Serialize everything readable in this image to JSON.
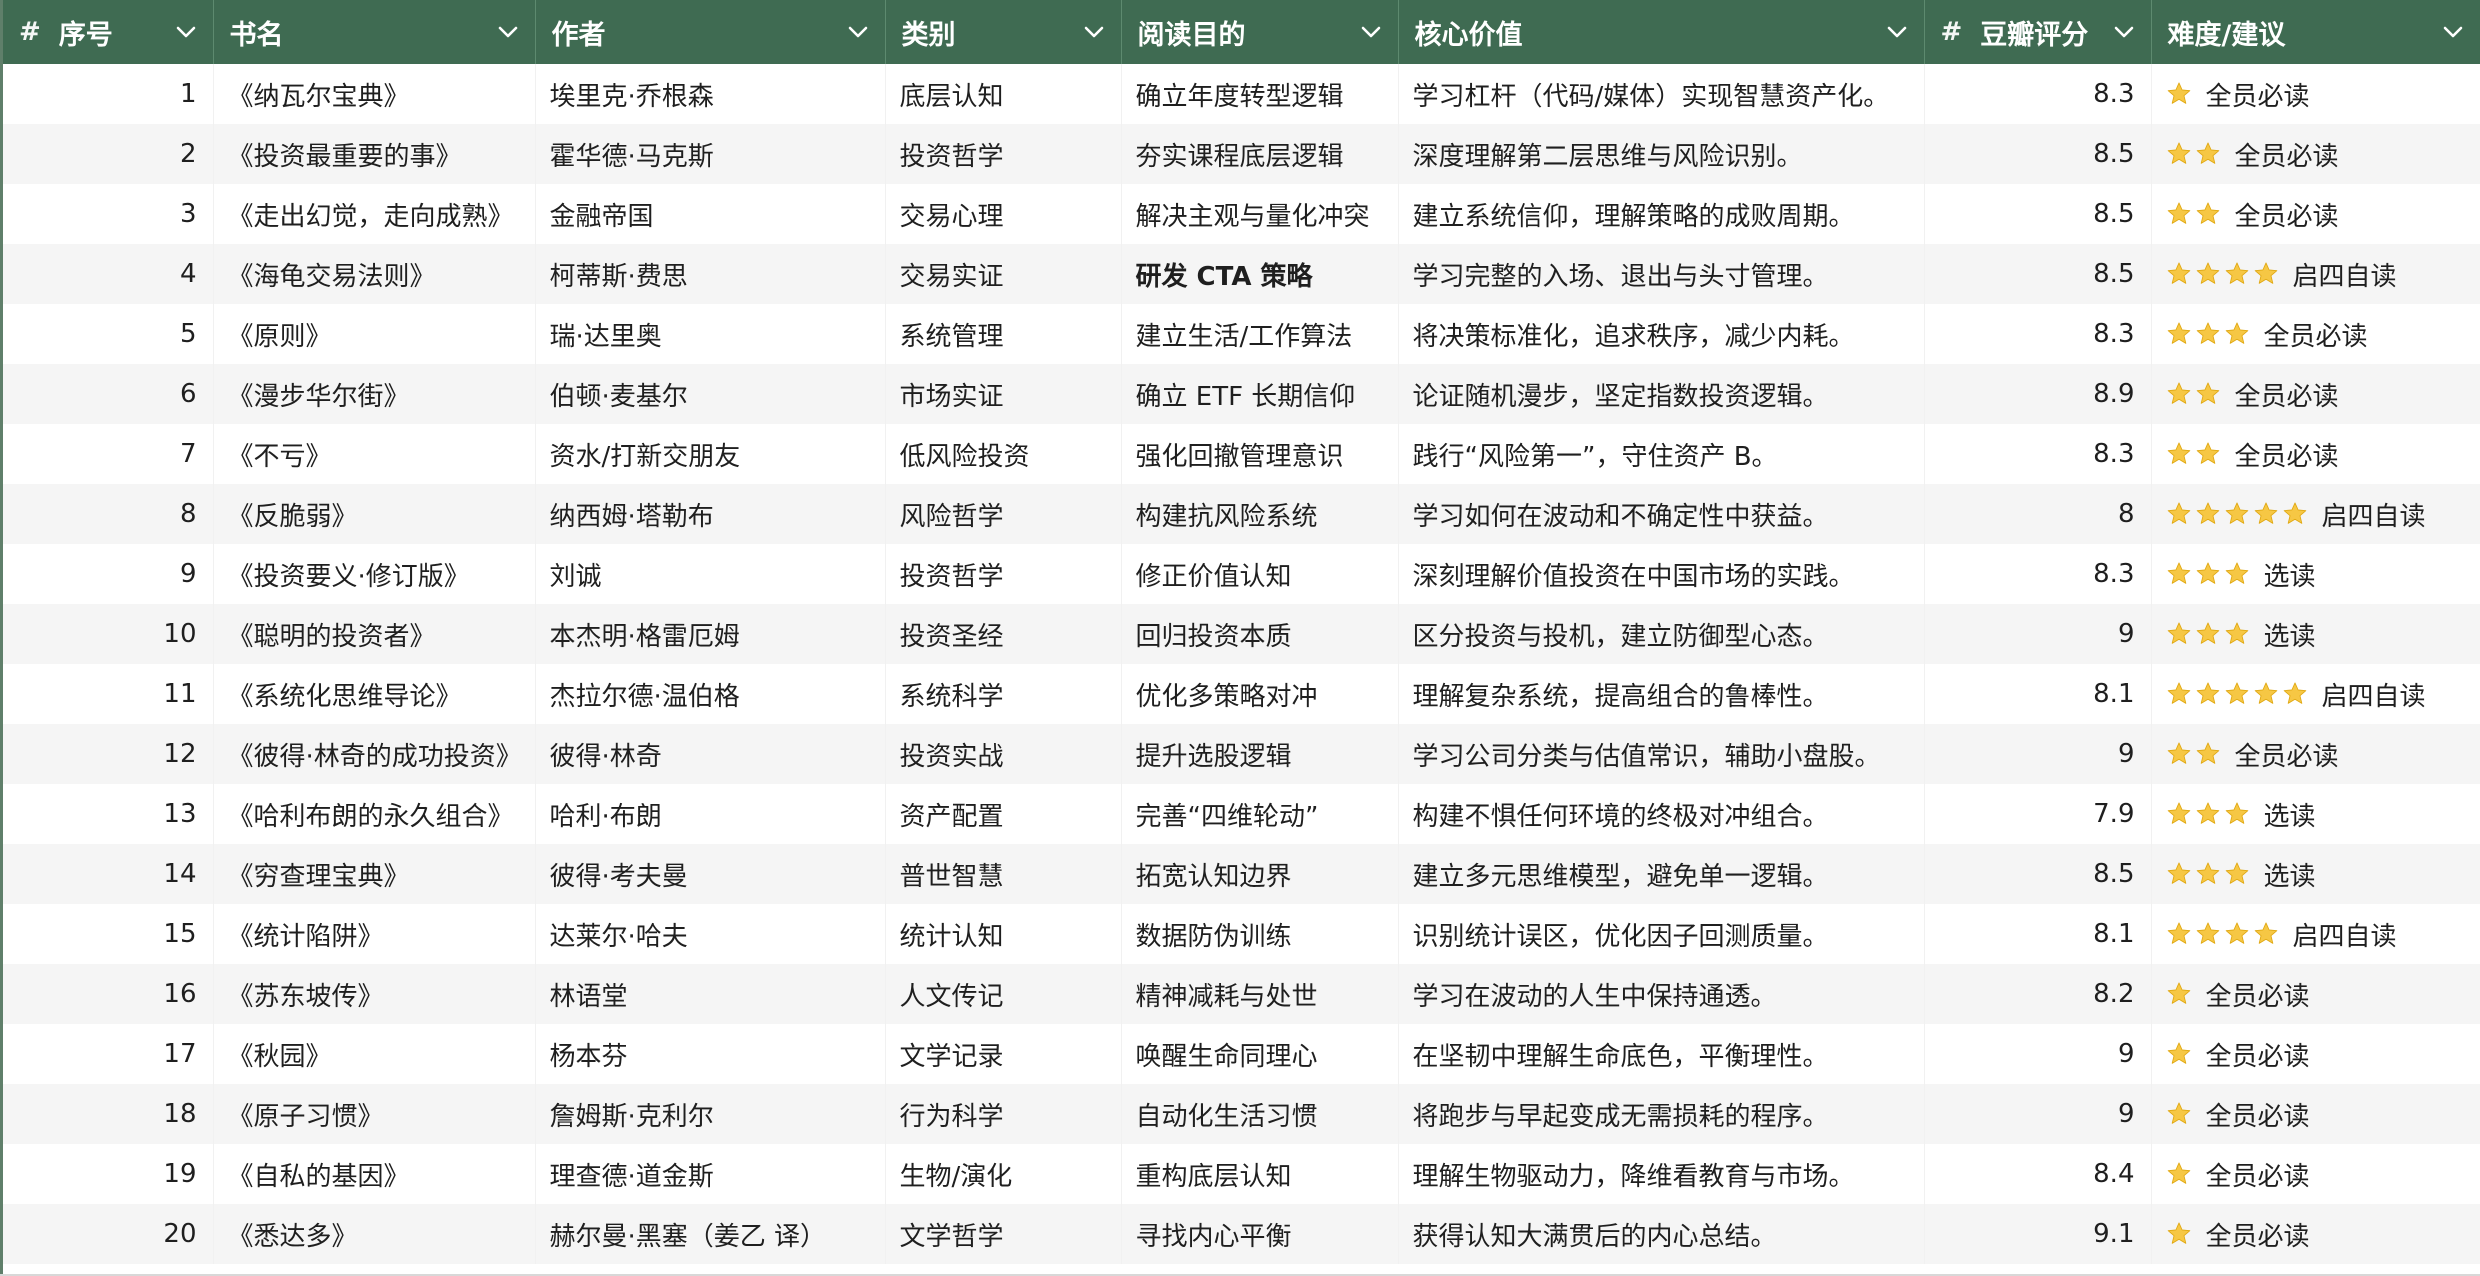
{
  "colors": {
    "header_bg": "#3f6b52",
    "header_text": "#ffffff",
    "row_alt": "#f5f5f5",
    "star_fill": "#f6c744"
  },
  "header": {
    "col_index": {
      "prefix": "#",
      "label": "序号"
    },
    "col_title": {
      "label": "书名"
    },
    "col_author": {
      "label": "作者"
    },
    "col_category": {
      "label": "类别"
    },
    "col_purpose": {
      "label": "阅读目的"
    },
    "col_value": {
      "label": "核心价值"
    },
    "col_score": {
      "prefix": "#",
      "label": "豆瓣评分"
    },
    "col_difficulty": {
      "label": "难度/建议"
    }
  },
  "rows": [
    {
      "index": "1",
      "title": "《纳瓦尔宝典》",
      "author": "埃里克·乔根森",
      "category": "底层认知",
      "purpose": "确立年度转型逻辑",
      "value": "学习杠杆（代码/媒体）实现智慧资产化。",
      "score": "8.3",
      "stars": 1,
      "advice": "全员必读"
    },
    {
      "index": "2",
      "title": "《投资最重要的事》",
      "author": "霍华德·马克斯",
      "category": "投资哲学",
      "purpose": "夯实课程底层逻辑",
      "value": "深度理解第二层思维与风险识别。",
      "score": "8.5",
      "stars": 2,
      "advice": "全员必读"
    },
    {
      "index": "3",
      "title": "《走出幻觉，走向成熟》",
      "author": "金融帝国",
      "category": "交易心理",
      "purpose": "解决主观与量化冲突",
      "value": "建立系统信仰，理解策略的成败周期。",
      "score": "8.5",
      "stars": 2,
      "advice": "全员必读"
    },
    {
      "index": "4",
      "title": "《海龟交易法则》",
      "author": "柯蒂斯·费思",
      "category": "交易实证",
      "purpose": "研发 CTA 策略",
      "purpose_bold": true,
      "value": "学习完整的入场、退出与头寸管理。",
      "score": "8.5",
      "stars": 4,
      "advice": "启四自读"
    },
    {
      "index": "5",
      "title": "《原则》",
      "author": "瑞·达里奥",
      "category": "系统管理",
      "purpose": "建立生活/工作算法",
      "value": "将决策标准化，追求秩序，减少内耗。",
      "score": "8.3",
      "stars": 3,
      "advice": "全员必读"
    },
    {
      "index": "6",
      "title": "《漫步华尔街》",
      "author": "伯顿·麦基尔",
      "category": "市场实证",
      "purpose": "确立 ETF 长期信仰",
      "value": "论证随机漫步，坚定指数投资逻辑。",
      "score": "8.9",
      "stars": 2,
      "advice": "全员必读"
    },
    {
      "index": "7",
      "title": "《不亏》",
      "author": "资水/打新交朋友",
      "category": "低风险投资",
      "purpose": "强化回撤管理意识",
      "value": "践行“风险第一”，守住资产 B。",
      "score": "8.3",
      "stars": 2,
      "advice": "全员必读"
    },
    {
      "index": "8",
      "title": "《反脆弱》",
      "author": "纳西姆·塔勒布",
      "category": "风险哲学",
      "purpose": "构建抗风险系统",
      "value": "学习如何在波动和不确定性中获益。",
      "score": "8",
      "stars": 5,
      "advice": "启四自读"
    },
    {
      "index": "9",
      "title": "《投资要义·修订版》",
      "author": "刘诚",
      "category": "投资哲学",
      "purpose": "修正价值认知",
      "value": "深刻理解价值投资在中国市场的实践。",
      "score": "8.3",
      "stars": 3,
      "advice": "选读"
    },
    {
      "index": "10",
      "title": "《聪明的投资者》",
      "author": "本杰明·格雷厄姆",
      "category": "投资圣经",
      "purpose": "回归投资本质",
      "value": "区分投资与投机，建立防御型心态。",
      "score": "9",
      "stars": 3,
      "advice": "选读"
    },
    {
      "index": "11",
      "title": "《系统化思维导论》",
      "author": "杰拉尔德·温伯格",
      "category": "系统科学",
      "purpose": "优化多策略对冲",
      "value": "理解复杂系统，提高组合的鲁棒性。",
      "score": "8.1",
      "stars": 5,
      "advice": "启四自读"
    },
    {
      "index": "12",
      "title": "《彼得·林奇的成功投资》",
      "author": "彼得·林奇",
      "category": "投资实战",
      "purpose": "提升选股逻辑",
      "value": "学习公司分类与估值常识，辅助小盘股。",
      "score": "9",
      "stars": 2,
      "advice": "全员必读"
    },
    {
      "index": "13",
      "title": "《哈利布朗的永久组合》",
      "author": "哈利·布朗",
      "category": "资产配置",
      "purpose": "完善“四维轮动”",
      "value": "构建不惧任何环境的终极对冲组合。",
      "score": "7.9",
      "stars": 3,
      "advice": "选读"
    },
    {
      "index": "14",
      "title": "《穷查理宝典》",
      "author": "彼得·考夫曼",
      "category": "普世智慧",
      "purpose": "拓宽认知边界",
      "value": "建立多元思维模型，避免单一逻辑。",
      "score": "8.5",
      "stars": 3,
      "advice": "选读"
    },
    {
      "index": "15",
      "title": "《统计陷阱》",
      "author": "达莱尔·哈夫",
      "category": "统计认知",
      "purpose": "数据防伪训练",
      "value": "识别统计误区，优化因子回测质量。",
      "score": "8.1",
      "stars": 4,
      "advice": "启四自读"
    },
    {
      "index": "16",
      "title": "《苏东坡传》",
      "author": "林语堂",
      "category": "人文传记",
      "purpose": "精神减耗与处世",
      "value": "学习在波动的人生中保持通透。",
      "score": "8.2",
      "stars": 1,
      "advice": "全员必读"
    },
    {
      "index": "17",
      "title": "《秋园》",
      "author": "杨本芬",
      "category": "文学记录",
      "purpose": "唤醒生命同理心",
      "value": "在坚韧中理解生命底色，平衡理性。",
      "score": "9",
      "stars": 1,
      "advice": "全员必读"
    },
    {
      "index": "18",
      "title": "《原子习惯》",
      "author": "詹姆斯·克利尔",
      "category": "行为科学",
      "purpose": "自动化生活习惯",
      "value": "将跑步与早起变成无需损耗的程序。",
      "score": "9",
      "stars": 1,
      "advice": "全员必读"
    },
    {
      "index": "19",
      "title": "《自私的基因》",
      "author": "理查德·道金斯",
      "category": "生物/演化",
      "purpose": "重构底层认知",
      "value": "理解生物驱动力，降维看教育与市场。",
      "score": "8.4",
      "stars": 1,
      "advice": "全员必读"
    },
    {
      "index": "20",
      "title": "《悉达多》",
      "author": "赫尔曼·黑塞（姜乙 译）",
      "category": "文学哲学",
      "purpose": "寻找内心平衡",
      "value": "获得认知大满贯后的内心总结。",
      "score": "9.1",
      "stars": 1,
      "advice": "全员必读"
    }
  ]
}
